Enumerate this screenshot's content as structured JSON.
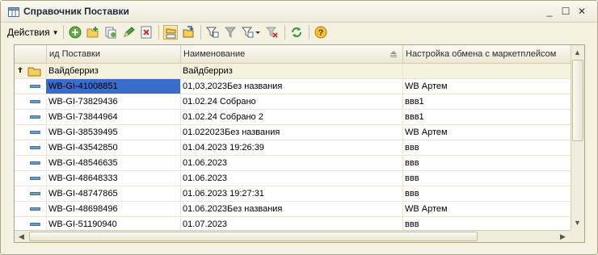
{
  "window": {
    "title": "Справочник Поставки",
    "controls": [
      "_",
      "☐",
      "✕"
    ]
  },
  "toolbar": {
    "actions_label": "Действия",
    "buttons": [
      "add-icon",
      "add-folder-icon",
      "copy-icon",
      "edit-icon",
      "delete-icon",
      "hierarchy-view-icon",
      "move-to-folder-icon",
      "filter-icon",
      "filter-by-value-icon",
      "filter-list-icon",
      "clear-filter-icon",
      "refresh-icon",
      "help-icon"
    ]
  },
  "grid": {
    "columns": [
      {
        "label": "ид Поставки"
      },
      {
        "label": "Наименование"
      },
      {
        "label": "Настройка обмена с маркетплейсом"
      }
    ],
    "group_row": {
      "id": "Вайдберриз",
      "name": "Вайдберриз",
      "exchange": ""
    },
    "rows": [
      {
        "id": "WB-GI-41008851",
        "name": "01,03,2023Без названия",
        "exchange": "WB Артем"
      },
      {
        "id": "WB-GI-73829436",
        "name": "01.02.24 Собрано",
        "exchange": "ввв1"
      },
      {
        "id": "WB-GI-73844964",
        "name": "01.02.24 Собрано 2",
        "exchange": "ввв1"
      },
      {
        "id": "WB-GI-38539495",
        "name": "01.022023Без названия",
        "exchange": "WB Артем"
      },
      {
        "id": "WB-GI-43542850",
        "name": "01.04.2023 19:26:39",
        "exchange": "ввв"
      },
      {
        "id": "WB-GI-48546635",
        "name": "01.06.2023",
        "exchange": "ввв"
      },
      {
        "id": "WB-GI-48648333",
        "name": "01.06.2023",
        "exchange": "ввв"
      },
      {
        "id": "WB-GI-48747865",
        "name": "01.06.2023 19:27:31",
        "exchange": "ввв"
      },
      {
        "id": "WB-GI-48698496",
        "name": "01.06.2023Без названия",
        "exchange": "WB Артем"
      },
      {
        "id": "WB-GI-51190940",
        "name": "01.07.2023",
        "exchange": "ввв"
      }
    ],
    "selected_row_index": 0
  },
  "colors": {
    "window_bg": "#f4f1e1",
    "selection": "#3a6cc9",
    "group_row_bg": "#f6f2de"
  }
}
